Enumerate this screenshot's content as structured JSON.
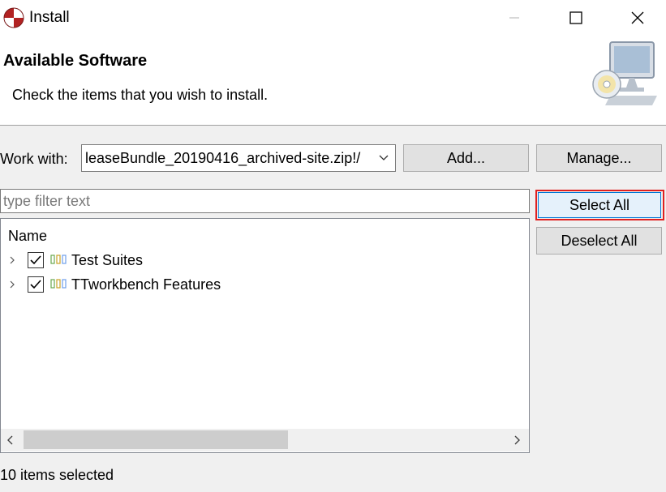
{
  "window": {
    "title": "Install",
    "controls": {
      "minimize_icon": "minimize-icon",
      "maximize_icon": "maximize-icon",
      "close_icon": "close-icon"
    }
  },
  "header": {
    "title": "Available Software",
    "description": "Check the items that you wish to install.",
    "banner_icon": "install-cd-monitor-icon"
  },
  "work_with": {
    "label": "Work with:",
    "value": "leaseBundle_20190416_archived-site.zip!/",
    "add_label": "Add...",
    "manage_label": "Manage..."
  },
  "filter": {
    "placeholder": "type filter text",
    "value": ""
  },
  "side_buttons": {
    "select_all_label": "Select All",
    "deselect_all_label": "Deselect All"
  },
  "tree": {
    "column_header": "Name",
    "items": [
      {
        "label": "Test Suites",
        "checked": true,
        "expandable": true
      },
      {
        "label": "TTworkbench Features",
        "checked": true,
        "expandable": true
      }
    ]
  },
  "status": {
    "text": "10 items selected"
  },
  "colors": {
    "highlight": "#e02020",
    "checkbox_check": "#000000",
    "feature_icon": [
      "#6aa84f",
      "#f1c232",
      "#6d9eeb"
    ]
  }
}
